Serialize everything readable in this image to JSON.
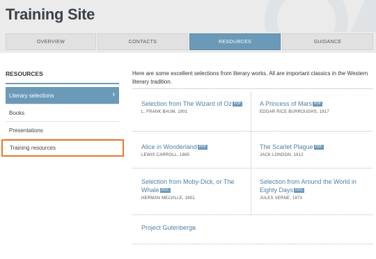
{
  "site": {
    "title": "Training Site"
  },
  "tabs": [
    {
      "label": "OVERVIEW",
      "active": false
    },
    {
      "label": "CONTACTS",
      "active": false
    },
    {
      "label": "RESOURCES",
      "active": true
    },
    {
      "label": "GUIDANCE",
      "active": false
    }
  ],
  "sidebar": {
    "heading": "RESOURCES",
    "items": [
      {
        "label": "Literary selections",
        "active": true,
        "arrow": "›"
      },
      {
        "label": "Books"
      },
      {
        "label": "Presentations"
      },
      {
        "label": "Training resources",
        "highlighted": true
      }
    ]
  },
  "main": {
    "intro": "Here are some excellent selections from literary works. All are important classics in the Western literary tradition.",
    "works": [
      {
        "title": "Selection from The Wizard of Oz",
        "badge": "PDF",
        "meta": "L. FRANK BAUM, 1901"
      },
      {
        "title": "A Princess of Mars",
        "badge": "PDF",
        "meta": "EDGAR RICE BURROUGHS, 1917"
      },
      {
        "title": "Alice in Wonderland",
        "badge": "PDF",
        "meta": "LEWIS CARROLL, 1865"
      },
      {
        "title": "The Scarlet Plague",
        "badge": "PDF",
        "meta": "JACK LONDON, 1912"
      },
      {
        "title": "Selection from Moby-Dick, or The Whale",
        "badge": "DOC",
        "meta": "HERMAN MELVILLE, 1851"
      },
      {
        "title": "Selection from Around the World in Eighty Days",
        "badge": "DOC",
        "meta": "JULES VERNE, 1873"
      }
    ],
    "link": {
      "label": "Project Gutenberg",
      "icon": "external-link-icon"
    }
  },
  "colors": {
    "accent": "#6b9ab8",
    "highlight": "#e8772e",
    "link": "#4f7fa3"
  }
}
